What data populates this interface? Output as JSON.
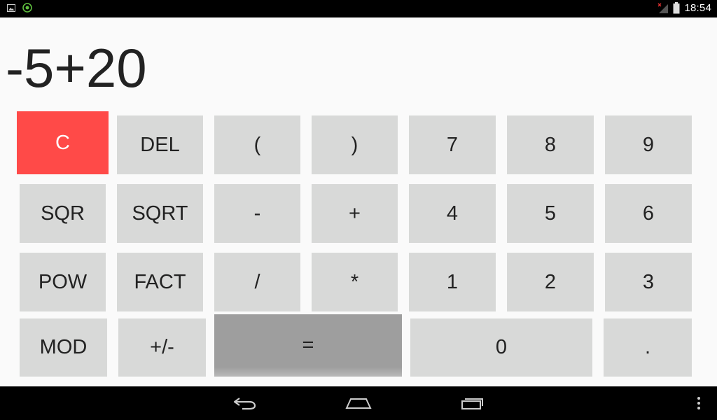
{
  "status_bar": {
    "time": "18:54",
    "left_icons": [
      "image-notification-icon",
      "app-notification-icon"
    ],
    "right_icons": [
      "signal-icon",
      "battery-icon"
    ]
  },
  "display": {
    "expression": "-5+20"
  },
  "keypad": {
    "rows": [
      [
        "C",
        "DEL",
        "(",
        ")",
        "7",
        "8",
        "9"
      ],
      [
        "SQR",
        "SQRT",
        "-",
        "+",
        "4",
        "5",
        "6"
      ],
      [
        "POW",
        "FACT",
        "/",
        "*",
        "1",
        "2",
        "3"
      ],
      [
        "MOD",
        "+/-",
        "=",
        "0",
        "."
      ]
    ],
    "colors": {
      "key_bg": "#d8d9d8",
      "clear_bg": "#ff4a48",
      "equals_bg": "#9e9e9e"
    }
  },
  "nav_bar": {
    "buttons": [
      "back-icon",
      "home-icon",
      "recents-icon",
      "overflow-menu-icon"
    ]
  }
}
